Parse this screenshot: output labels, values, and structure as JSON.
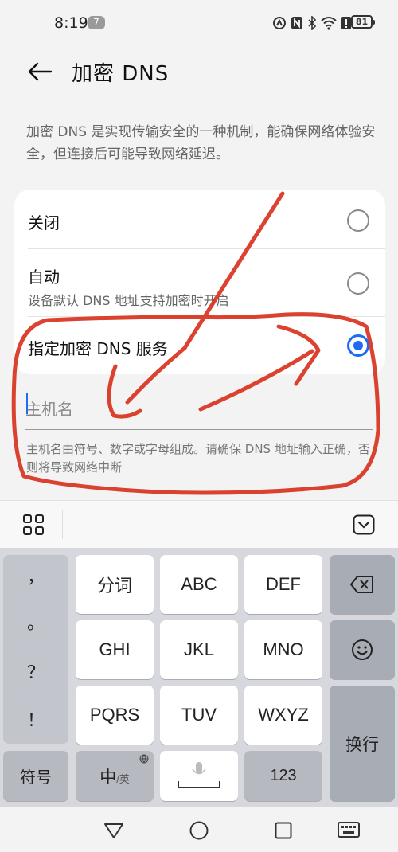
{
  "status_bar": {
    "time": "8:19",
    "notification_count": "7",
    "battery": "81",
    "icons": [
      "nfc-icon",
      "bluetooth-icon",
      "wifi-icon",
      "alert-icon"
    ]
  },
  "header": {
    "title": "加密 DNS"
  },
  "description": "加密 DNS 是实现传输安全的一种机制，能确保网络体验安全，但连接后可能导致网络延迟。",
  "options": [
    {
      "label": "关闭",
      "subtitle": "",
      "selected": false
    },
    {
      "label": "自动",
      "subtitle": "设备默认 DNS 地址支持加密时开启",
      "selected": false
    },
    {
      "label": "指定加密 DNS 服务",
      "subtitle": "",
      "selected": true
    }
  ],
  "host_field": {
    "placeholder": "主机名",
    "value": ""
  },
  "hint": "主机名由符号、数字或字母组成。请确保 DNS 地址输入正确，否则将导致网络中断",
  "keyboard": {
    "symbols": [
      "，",
      "。",
      "？",
      "！"
    ],
    "rows": [
      [
        "分词",
        "ABC",
        "DEF"
      ],
      [
        "GHI",
        "JKL",
        "MNO"
      ],
      [
        "PQRS",
        "TUV",
        "WXYZ"
      ]
    ],
    "bottom": {
      "symbol_key": "符号",
      "lang_main": "中",
      "lang_sub": "/英",
      "num_key": "123"
    },
    "enter_key": "换行"
  },
  "colors": {
    "accent": "#1e6cf2",
    "annotation": "#d8321e"
  }
}
